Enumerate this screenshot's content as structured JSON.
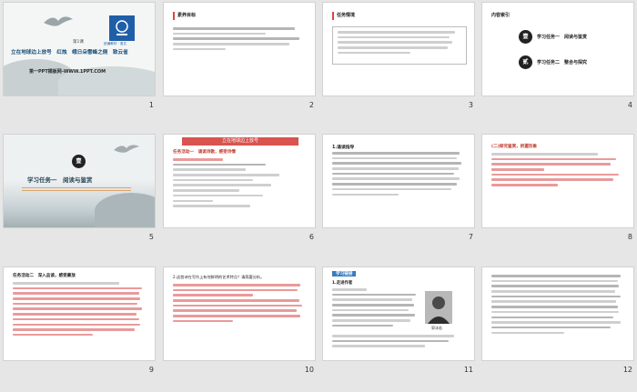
{
  "slides": [
    {
      "number": "1",
      "tag": "第1课",
      "title": "立在地球边上放号　红烛　峨日朵雪峰之侧　致云雀",
      "watermark": "第一PPT模板网-WWW.1PPT.COM",
      "logo_text": "统编教材 · 语文"
    },
    {
      "number": "2",
      "heading": "素养目标"
    },
    {
      "number": "3",
      "heading": "任务情境"
    },
    {
      "number": "4",
      "heading": "内容索引",
      "items": [
        {
          "badge": "壹",
          "label": "学习任务一　阅读与鉴赏"
        },
        {
          "badge": "贰",
          "label": "学习任务二　整合与探究"
        }
      ]
    },
    {
      "number": "5",
      "badge": "壹",
      "label": "学习任务一　阅读与鉴赏"
    },
    {
      "number": "6",
      "banner": "立在地球边上放号",
      "heading": "任务活动一　诵读诗歌，感受诗情"
    },
    {
      "number": "7",
      "heading": "1.诵读指导"
    },
    {
      "number": "8",
      "heading": "(二)探究鉴赏，把握形象"
    },
    {
      "number": "9",
      "heading": "任务活动二　深入品读，感受豪放"
    },
    {
      "number": "10",
      "heading": "2.这首诗在写作上有何鲜明的艺术特点？请简要分析。"
    },
    {
      "number": "11",
      "heading": "学习链接",
      "subheading": "1.走进作者",
      "photo_caption": "郭沫若"
    },
    {
      "number": "12"
    }
  ],
  "colors": {
    "accent_red": "#c0392b",
    "blue_logo": "#1f5fa8",
    "banner_red": "#d9534f",
    "badge_dark": "#222222"
  }
}
